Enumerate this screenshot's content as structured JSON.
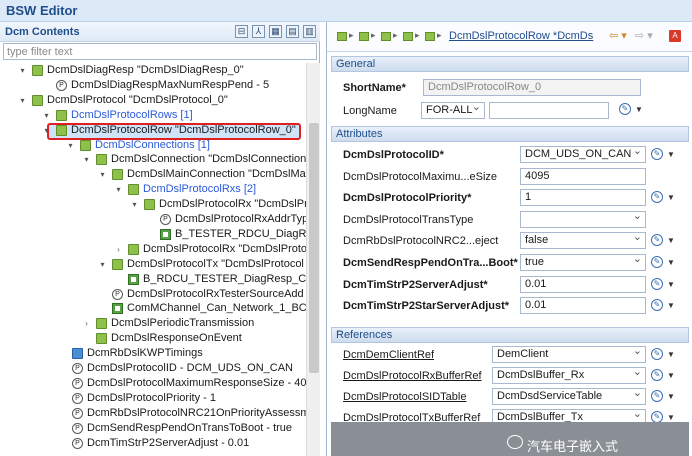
{
  "title": "BSW Editor",
  "left": {
    "header": "Dcm Contents",
    "filter_placeholder": "type filter text",
    "tools": [
      "⊟",
      "⅄",
      "▦",
      "▤",
      "▥"
    ],
    "tree": [
      {
        "text": "DcmDslDiagResp \"DcmDslDiagResp_0\"",
        "icon": "folder",
        "twisty": "▾"
      },
      {
        "text": "DcmDslDiagRespMaxNumRespPend - 5",
        "icon": "param",
        "twisty": ""
      },
      {
        "text": "DcmDslProtocol \"DcmDslProtocol_0\"",
        "icon": "folder",
        "twisty": "▾"
      },
      {
        "text": "DcmDslProtocolRows [1]",
        "icon": "folder",
        "twisty": "▾"
      },
      {
        "text": "DcmDslProtocolRow \"DcmDslProtocolRow_0\"",
        "icon": "folder",
        "twisty": "▾"
      },
      {
        "text": "DcmDslConnections [1]",
        "icon": "folder",
        "twisty": "▾"
      },
      {
        "text": "DcmDslConnection \"DcmDslConnection_0",
        "icon": "folder",
        "twisty": "▾"
      },
      {
        "text": "DcmDslMainConnection \"DcmDslMainC",
        "icon": "folder",
        "twisty": "▾"
      },
      {
        "text": "DcmDslProtocolRxs [2]",
        "icon": "folder",
        "twisty": "▾"
      },
      {
        "text": "DcmDslProtocolRx \"DcmDslProto",
        "icon": "folder",
        "twisty": "▾"
      },
      {
        "text": "DcmDslProtocolRxAddrType -",
        "icon": "param",
        "twisty": ""
      },
      {
        "text": "B_TESTER_RDCU_DiagReq_Can",
        "icon": "ref",
        "twisty": ""
      },
      {
        "text": "DcmDslProtocolRx \"DcmDslProto",
        "icon": "folder",
        "twisty": "›"
      },
      {
        "text": "DcmDslProtocolTx \"DcmDslProtocol",
        "icon": "folder",
        "twisty": "▾"
      },
      {
        "text": "B_RDCU_TESTER_DiagResp_CanC",
        "icon": "ref",
        "twisty": ""
      },
      {
        "text": "DcmDslProtocolRxTesterSourceAdd",
        "icon": "param",
        "twisty": ""
      },
      {
        "text": "ComMChannel_Can_Network_1_BCA",
        "icon": "ref",
        "twisty": ""
      },
      {
        "text": "DcmDslPeriodicTransmission",
        "icon": "folder",
        "twisty": "›"
      },
      {
        "text": "DcmDslResponseOnEvent",
        "icon": "folder",
        "twisty": ""
      },
      {
        "text": "DcmRbDslKWPTimings",
        "icon": "folder-blue",
        "twisty": ""
      },
      {
        "text": "DcmDslProtocolID - DCM_UDS_ON_CAN",
        "icon": "param",
        "twisty": ""
      },
      {
        "text": "DcmDslProtocolMaximumResponseSize - 40",
        "icon": "param",
        "twisty": ""
      },
      {
        "text": "DcmDslProtocolPriority - 1",
        "icon": "param",
        "twisty": ""
      },
      {
        "text": "DcmRbDslProtocolNRC21OnPriorityAssessm",
        "icon": "param",
        "twisty": ""
      },
      {
        "text": "DcmSendRespPendOnTransToBoot - true",
        "icon": "param",
        "twisty": ""
      },
      {
        "text": "DcmTimStrP2ServerAdjust - 0.01",
        "icon": "param",
        "twisty": ""
      }
    ]
  },
  "right": {
    "breadcrumb_link": "DcmDslProtocolRow *DcmDs",
    "sections": {
      "general": "General",
      "attributes": "Attributes",
      "references": "References"
    },
    "general": {
      "shortname_label": "ShortName*",
      "shortname_value": "DcmDslProtocolRow_0",
      "longname_label": "LongName",
      "longname_lang": "FOR-ALL",
      "longname_value": ""
    },
    "attributes": [
      {
        "label": "DcmDslProtocolID*",
        "value": "DCM_UDS_ON_CAN",
        "bold": true,
        "dropdown": true
      },
      {
        "label": "DcmDslProtocolMaximu...eSize",
        "value": "4095",
        "bold": false,
        "dropdown": false
      },
      {
        "label": "DcmDslProtocolPriority*",
        "value": "1",
        "bold": true,
        "dropdown": false
      },
      {
        "label": "DcmDslProtocolTransType",
        "value": "",
        "bold": false,
        "dropdown": true
      },
      {
        "label": "DcmRbDslProtocolNRC2...eject",
        "value": "false",
        "bold": false,
        "dropdown": true
      },
      {
        "label": "DcmSendRespPendOnTra...Boot*",
        "value": "true",
        "bold": true,
        "dropdown": true
      },
      {
        "label": "DcmTimStrP2ServerAdjust*",
        "value": "0.01",
        "bold": true,
        "dropdown": false
      },
      {
        "label": "DcmTimStrP2StarServerAdjust*",
        "value": "0.01",
        "bold": true,
        "dropdown": false
      }
    ],
    "references": [
      {
        "label": "DcmDemClientRef",
        "value": "DemClient"
      },
      {
        "label": "DcmDslProtocolRxBufferRef",
        "value": "DcmDslBuffer_Rx"
      },
      {
        "label": "DcmDslProtocolSIDTable",
        "value": "DcmDsdServiceTable"
      },
      {
        "label": "DcmDslProtocolTxBufferRef",
        "value": "DcmDslBuffer_Tx"
      }
    ],
    "watermark": "汽车电子嵌入式"
  }
}
